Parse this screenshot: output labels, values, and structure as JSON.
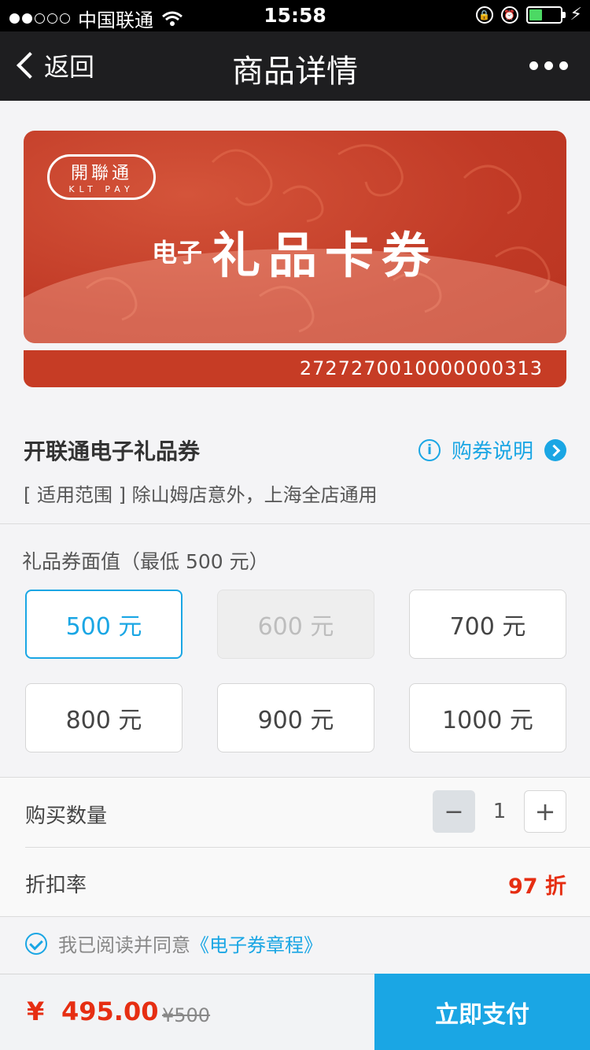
{
  "status_bar": {
    "carrier": "中国联通",
    "time": "15:58"
  },
  "nav": {
    "back_label": "返回",
    "title": "商品详情"
  },
  "card": {
    "logo_mark": "開聯通",
    "logo_text": "KLT PAY",
    "small_title": "电子",
    "big_title": "礼品卡券",
    "card_number": "2727270010000000313"
  },
  "product": {
    "name": "开联通电子礼品券",
    "info_label": "购券说明",
    "scope": "[ 适用范围 ] 除山姆店意外，上海全店通用"
  },
  "denomination": {
    "label": "礼品券面值（最低 500 元）",
    "options": [
      {
        "label": "500 元",
        "state": "selected"
      },
      {
        "label": "600 元",
        "state": "disabled"
      },
      {
        "label": "700 元",
        "state": "normal"
      },
      {
        "label": "800 元",
        "state": "normal"
      },
      {
        "label": "900 元",
        "state": "normal"
      },
      {
        "label": "1000 元",
        "state": "normal"
      }
    ]
  },
  "quantity": {
    "label": "购买数量",
    "minus": "−",
    "value": "1",
    "plus": "+"
  },
  "discount": {
    "label": "折扣率",
    "value": "97 折"
  },
  "agreement": {
    "text": "我已阅读并同意",
    "link": "《电子券章程》"
  },
  "footer": {
    "currency": "¥",
    "price": "495.00",
    "original_price": "¥500",
    "pay_label": "立即支付"
  },
  "colors": {
    "accent": "#1aa6e4",
    "price_red": "#e62e12",
    "card_red": "#c13a26"
  }
}
